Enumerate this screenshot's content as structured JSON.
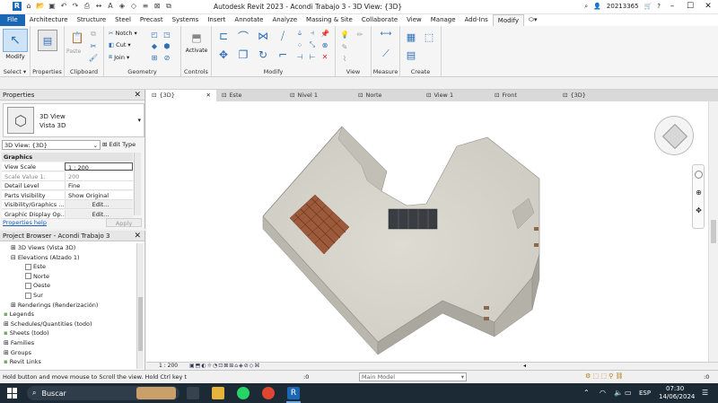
{
  "app_title": "Autodesk Revit 2023 - Acondi Trabajo 3 - 3D View: {3D}",
  "user": "20213365",
  "ribbon_tabs": [
    "File",
    "Architecture",
    "Structure",
    "Steel",
    "Precast",
    "Systems",
    "Insert",
    "Annotate",
    "Analyze",
    "Massing & Site",
    "Collaborate",
    "View",
    "Manage",
    "Add-Ins",
    "Modify"
  ],
  "active_tab": "Modify",
  "ribbon": {
    "select_label": "Select",
    "modify_label": "Modify",
    "properties_label": "Properties",
    "clipboard_label": "Clipboard",
    "paste_label": "Paste",
    "notch_label": "Notch",
    "cut_label": "Cut",
    "join_label": "Join",
    "geometry_label": "Geometry",
    "activate_label": "Activate",
    "controls_label": "Controls",
    "modify_group_label": "Modify",
    "view_label": "View",
    "measure_label": "Measure",
    "create_label": "Create"
  },
  "properties": {
    "header": "Properties",
    "type_name": "3D View",
    "type_sub": "Vista 3D",
    "selector": "3D View: {3D}",
    "edit_type": "Edit Type",
    "section": "Graphics",
    "rows": [
      {
        "k": "View Scale",
        "v": "1 : 200"
      },
      {
        "k": "Scale Value    1:",
        "v": "200"
      },
      {
        "k": "Detail Level",
        "v": "Fine"
      },
      {
        "k": "Parts Visibility",
        "v": "Show Original"
      },
      {
        "k": "Visibility/Graphics ...",
        "v": "Edit..."
      },
      {
        "k": "Graphic Display Op...",
        "v": "Edit..."
      }
    ],
    "help": "Properties help",
    "apply": "Apply"
  },
  "browser": {
    "header": "Project Browser - Acondi Trabajo 3",
    "items": [
      {
        "label": "3D Views (Vista 3D)",
        "indent": 1,
        "exp": "+"
      },
      {
        "label": "Elevations (Alzado 1)",
        "indent": 1,
        "exp": "-"
      },
      {
        "label": "Este",
        "indent": 3,
        "exp": ""
      },
      {
        "label": "Norte",
        "indent": 3,
        "exp": ""
      },
      {
        "label": "Oeste",
        "indent": 3,
        "exp": ""
      },
      {
        "label": "Sur",
        "indent": 3,
        "exp": ""
      },
      {
        "label": "Renderings (Renderización)",
        "indent": 1,
        "exp": "+"
      },
      {
        "label": "Legends",
        "indent": 0,
        "exp": ""
      },
      {
        "label": "Schedules/Quantities (todo)",
        "indent": 0,
        "exp": "+"
      },
      {
        "label": "Sheets (todo)",
        "indent": 0,
        "exp": ""
      },
      {
        "label": "Families",
        "indent": 0,
        "exp": "+"
      },
      {
        "label": "Groups",
        "indent": 0,
        "exp": "+"
      },
      {
        "label": "Revit Links",
        "indent": 0,
        "exp": ""
      }
    ]
  },
  "view_tabs": [
    {
      "label": "{3D}",
      "active": true
    },
    {
      "label": "Este",
      "active": false
    },
    {
      "label": "Nivel 1",
      "active": false
    },
    {
      "label": "Norte",
      "active": false
    },
    {
      "label": "View 1",
      "active": false
    },
    {
      "label": "Front",
      "active": false
    },
    {
      "label": "{3D}",
      "active": false
    }
  ],
  "view_scale": "1 : 200",
  "status_text": "Hold button and move mouse to Scroll the view. Hold Ctrl key t",
  "status_zero": ":0",
  "main_model": "Main Model",
  "status_filter": ":0",
  "taskbar": {
    "search": "Buscar",
    "lang": "ESP",
    "time": "07:30",
    "date": "14/06/2024"
  },
  "colors": {
    "accent": "#1a67b5",
    "building": "#cfcdc3",
    "roof": "#d8d6cc",
    "wood": "#8c4a2f"
  }
}
